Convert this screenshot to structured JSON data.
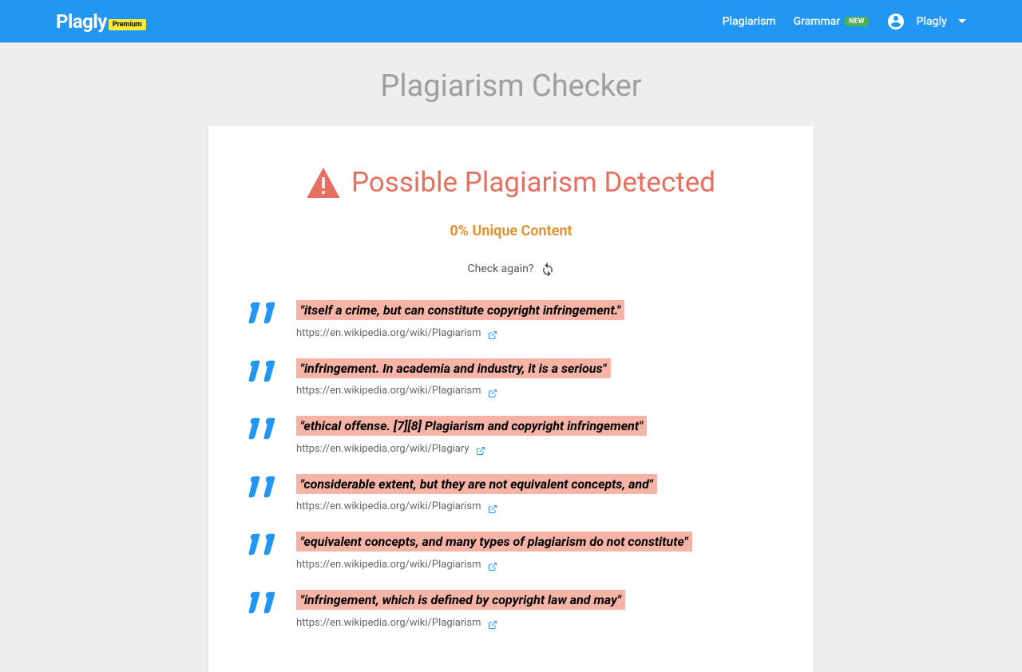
{
  "header": {
    "logo": "Plagly",
    "premium": "Premium",
    "nav": {
      "plagiarism": "Plagiarism",
      "grammar": "Grammar",
      "new_badge": "NEW"
    },
    "user": "Plagly"
  },
  "page": {
    "title": "Plagiarism Checker"
  },
  "detection": {
    "title": "Possible Plagiarism Detected",
    "unique": "0% Unique Content",
    "check_again": "Check again?"
  },
  "results": [
    {
      "snippet": "\"itself a crime, but can constitute copyright infringement.\"",
      "url": "https://en.wikipedia.org/wiki/Plagiarism"
    },
    {
      "snippet": "\"infringement. In academia and industry, it is a serious\"",
      "url": "https://en.wikipedia.org/wiki/Plagiarism"
    },
    {
      "snippet": "\"ethical offense. [7][8] Plagiarism and copyright infringement\"",
      "url": "https://en.wikipedia.org/wiki/Plagiary"
    },
    {
      "snippet": "\"considerable extent, but they are not equivalent concepts, and\"",
      "url": "https://en.wikipedia.org/wiki/Plagiarism"
    },
    {
      "snippet": "\"equivalent concepts, and many types of plagiarism do not constitute\"",
      "url": "https://en.wikipedia.org/wiki/Plagiarism"
    },
    {
      "snippet": "\"infringement, which is defined by copyright law and may\"",
      "url": "https://en.wikipedia.org/wiki/Plagiarism"
    }
  ]
}
